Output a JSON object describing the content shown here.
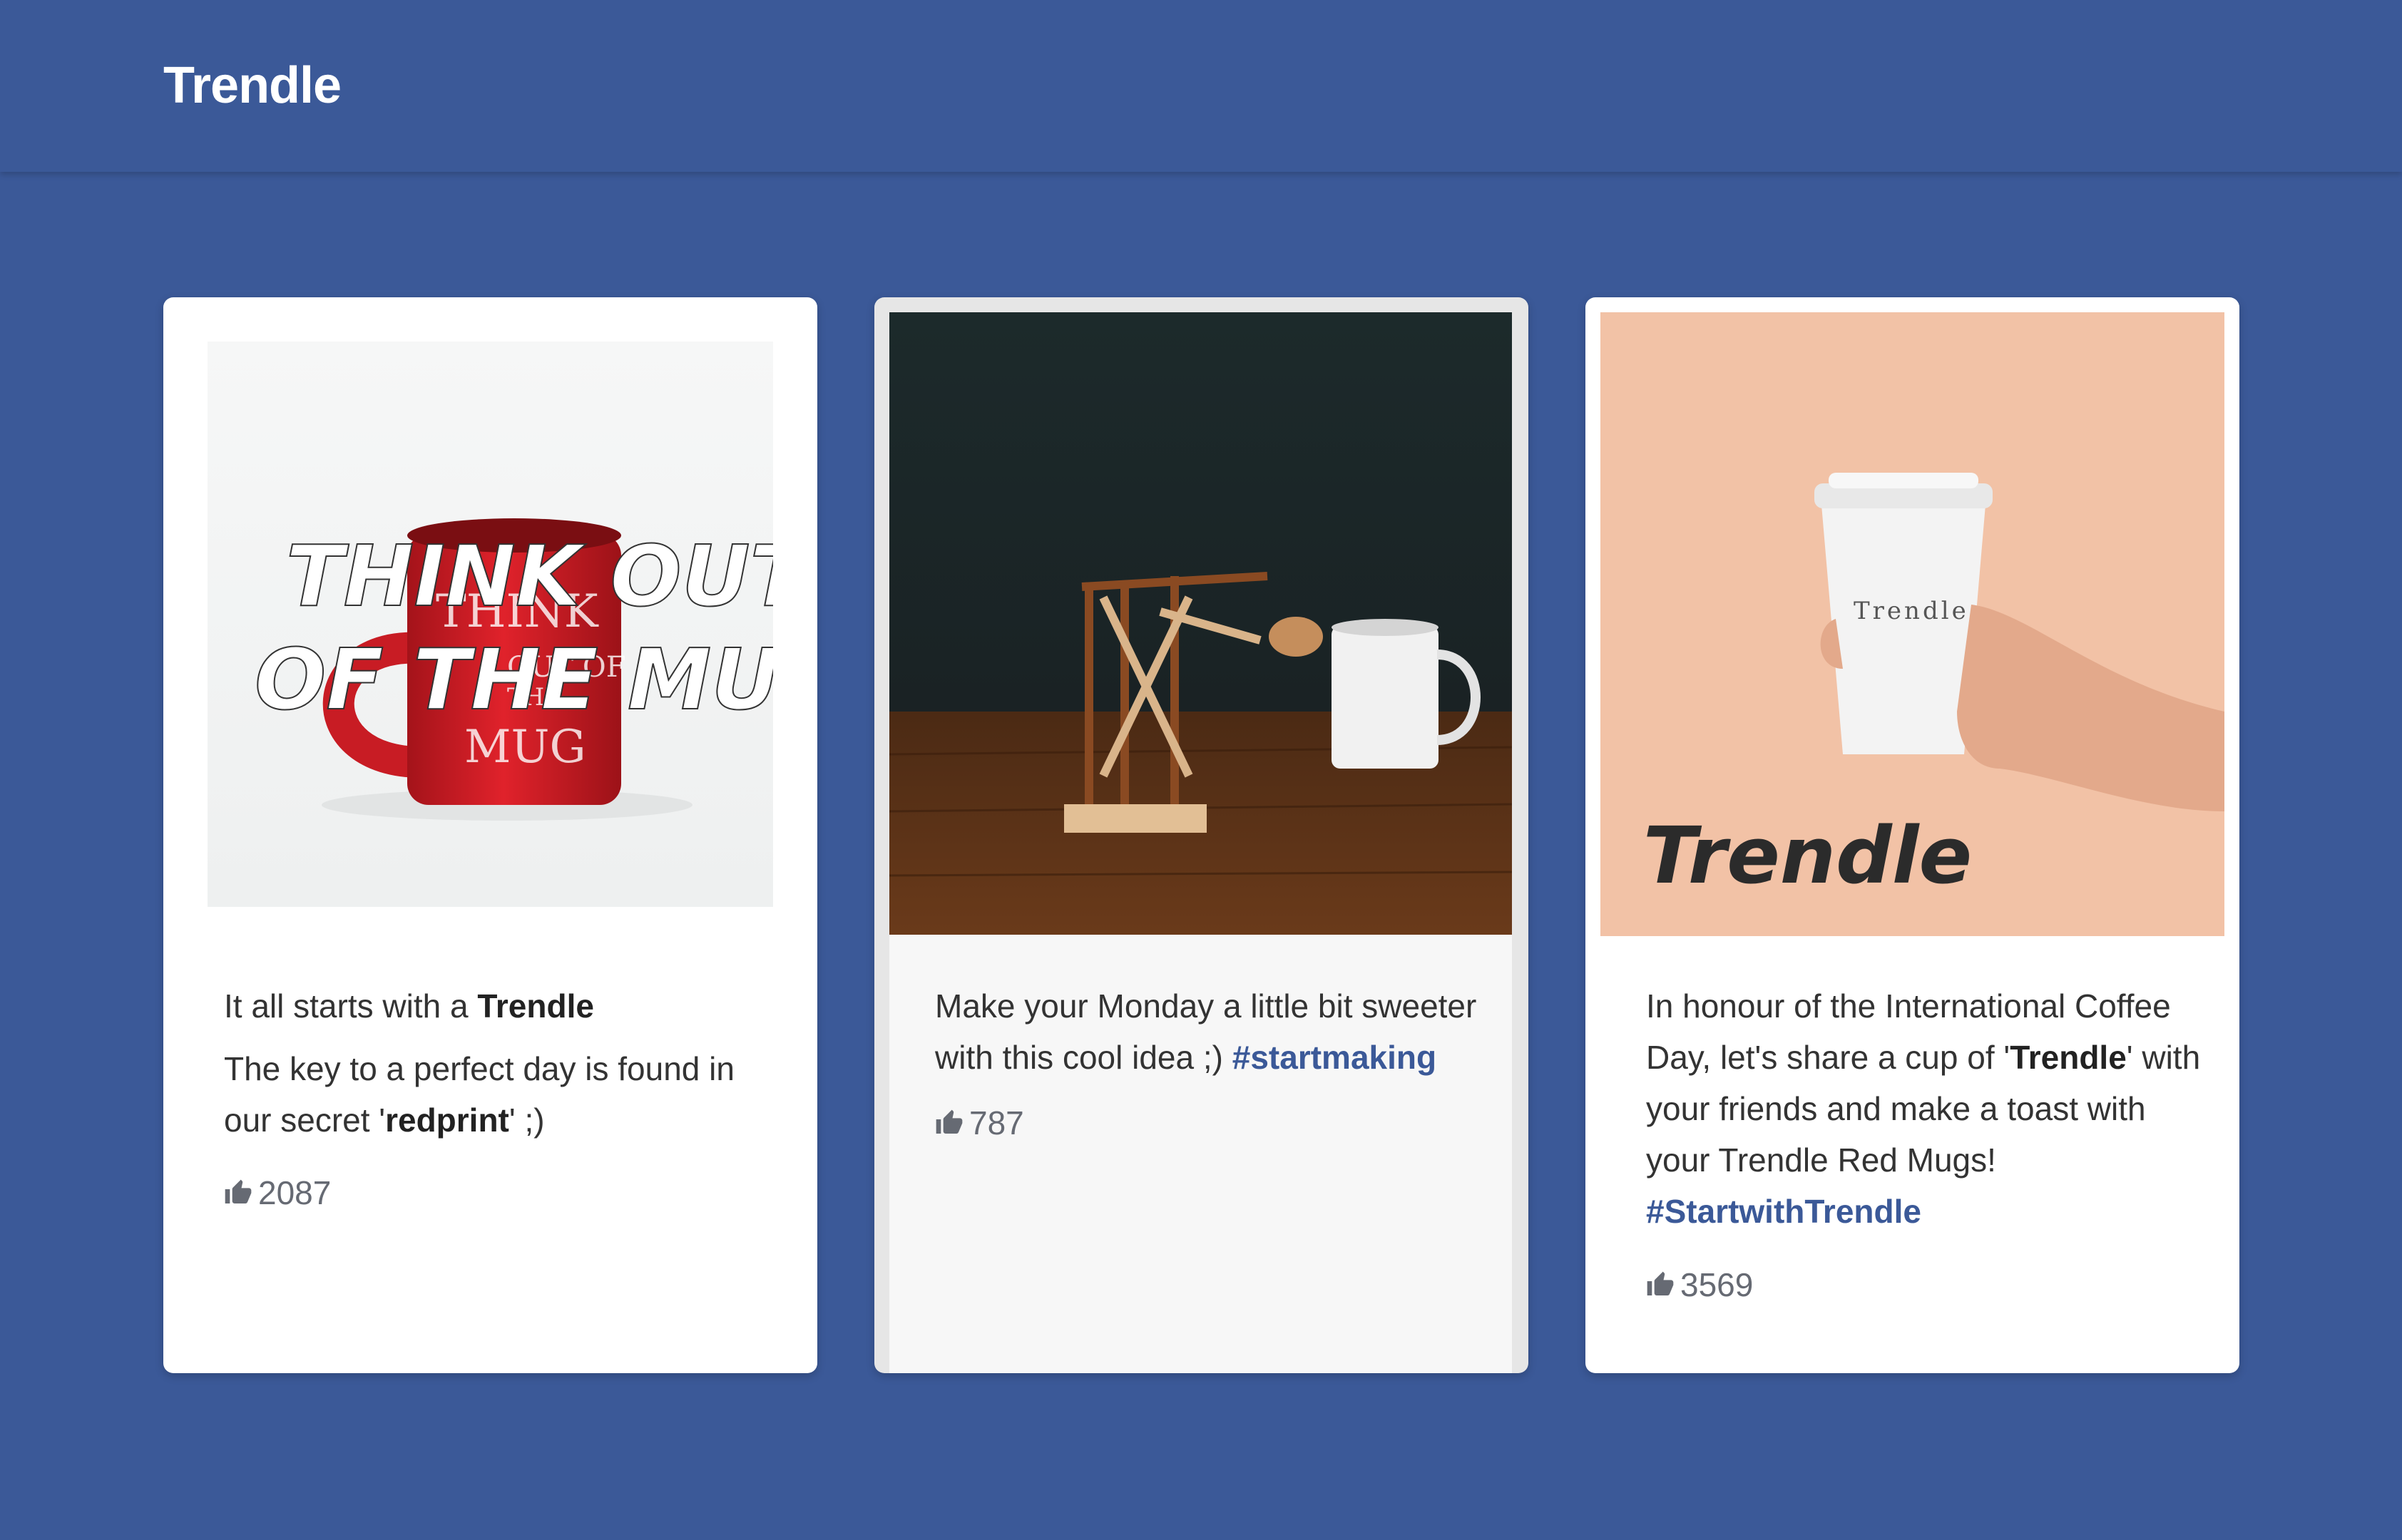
{
  "header": {
    "brand": "Trendle"
  },
  "posts": [
    {
      "image_label": "photo of red mug with overlay text",
      "image_overlay": [
        "THINK OUT",
        "OF THE MUG"
      ],
      "mug_print": [
        "THINK",
        "OUT OF",
        "THE",
        "MUG"
      ],
      "line1_prefix": "It all starts with a ",
      "line1_bold": "Trendle",
      "line2_prefix": "The key to a perfect day is found in our secret '",
      "line2_bold": "redprint",
      "line2_suffix": "' ;)",
      "likes": "2087"
    },
    {
      "text": "Make your Monday a little bit sweeter with this cool idea ;)",
      "hashtag": "#startmaking",
      "likes": "787"
    },
    {
      "cup_print": "Trendle",
      "image_overlay": "Trendle",
      "text_prefix": "In honour of the International Coffee Day, let's share a cup of '",
      "text_bold": "Trendle",
      "text_suffix": "' with your friends and make a toast with your Trendle Red Mugs! ",
      "hashtag": "#StartwithTrendle",
      "likes": "3569"
    }
  ],
  "colors": {
    "brand_blue": "#3b5998",
    "card_bg": "#ffffff",
    "text": "#333333",
    "muted": "#666a73"
  },
  "icons": {
    "like": "thumbs-up-icon"
  }
}
